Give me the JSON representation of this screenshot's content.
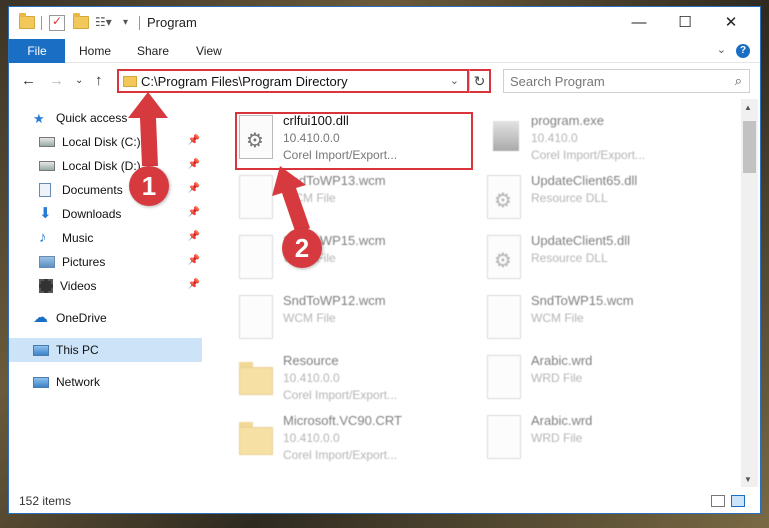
{
  "window": {
    "title": "Program",
    "controls": {
      "minimize": "—",
      "maximize": "☐",
      "close": "✕"
    }
  },
  "ribbon": {
    "tabs": [
      "File",
      "Home",
      "Share",
      "View"
    ],
    "help": "?"
  },
  "address": {
    "path": "C:\\Program Files\\Program Directory",
    "search_placeholder": "Search Program"
  },
  "sidebar": {
    "items": [
      {
        "label": "Quick access",
        "icon": "star-icon",
        "pinned": false
      },
      {
        "label": "Local Disk (C:)",
        "icon": "drive-icon",
        "pinned": true
      },
      {
        "label": "Local Disk (D:)",
        "icon": "drive-icon",
        "pinned": true
      },
      {
        "label": "Documents",
        "icon": "documents-icon",
        "pinned": true
      },
      {
        "label": "Downloads",
        "icon": "download-icon",
        "pinned": true
      },
      {
        "label": "Music",
        "icon": "music-icon",
        "pinned": true
      },
      {
        "label": "Pictures",
        "icon": "pictures-icon",
        "pinned": true
      },
      {
        "label": "Videos",
        "icon": "videos-icon",
        "pinned": true
      },
      {
        "label": "OneDrive",
        "icon": "cloud-icon",
        "pinned": false
      },
      {
        "label": "This PC",
        "icon": "computer-icon",
        "pinned": false,
        "selected": true
      },
      {
        "label": "Network",
        "icon": "network-icon",
        "pinned": false
      }
    ]
  },
  "files": [
    {
      "name": "crlfui100.dll",
      "line2": "10.410.0.0",
      "line3": "Corel Import/Export...",
      "kind": "dll",
      "highlighted": true
    },
    {
      "name": "program.exe",
      "line2": "10.410.0",
      "line3": "Corel Import/Export...",
      "kind": "exe"
    },
    {
      "name": "SndToWP13.wcm",
      "line2": "WCM File",
      "line3": "",
      "kind": "file"
    },
    {
      "name": "UpdateClient65.dll",
      "line2": "Resource DLL",
      "line3": "",
      "kind": "dll"
    },
    {
      "name": "SndToWP15.wcm",
      "line2": "WCM File",
      "line3": "",
      "kind": "file"
    },
    {
      "name": "UpdateClient5.dll",
      "line2": "Resource DLL",
      "line3": "",
      "kind": "dll"
    },
    {
      "name": "SndToWP12.wcm",
      "line2": "WCM File",
      "line3": "",
      "kind": "file"
    },
    {
      "name": "SndToWP15.wcm",
      "line2": "WCM File",
      "line3": "",
      "kind": "file"
    },
    {
      "name": "Resource",
      "line2": "10.410.0.0",
      "line3": "Corel Import/Export...",
      "kind": "folder"
    },
    {
      "name": "Arabic.wrd",
      "line2": "WRD File",
      "line3": "",
      "kind": "file"
    },
    {
      "name": "Microsoft.VC90.CRT",
      "line2": "10.410.0.0",
      "line3": "Corel Import/Export...",
      "kind": "folder"
    },
    {
      "name": "Arabic.wrd",
      "line2": "WRD File",
      "line3": "",
      "kind": "file"
    }
  ],
  "status": {
    "count": "152 items"
  },
  "callouts": [
    "1",
    "2"
  ],
  "colors": {
    "accent": "#1a6fc4",
    "highlight": "#d9343c",
    "selected": "#cde3f7"
  }
}
